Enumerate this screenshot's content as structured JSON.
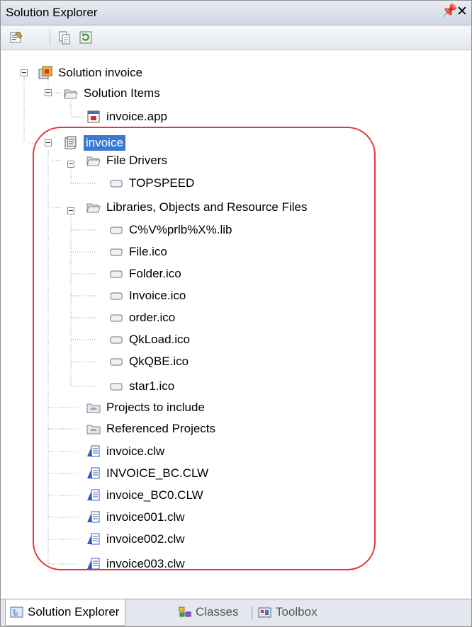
{
  "window": {
    "title": "Solution Explorer",
    "pin_glyph": "Ũ",
    "close_glyph": "✕"
  },
  "toolbar": {
    "buttons": [
      "properties-icon",
      "show-all-files-icon",
      "refresh-icon"
    ]
  },
  "tree": {
    "solution": {
      "label": "Solution invoice",
      "icon": "solution-icon"
    },
    "solution_items": {
      "label": "Solution Items",
      "icon": "folder-open-icon"
    },
    "invoice_app": {
      "label": "invoice.app",
      "icon": "app-file-icon"
    },
    "project": {
      "label": "invoice",
      "icon": "project-icon",
      "selected": true
    },
    "file_drivers": {
      "label": "File Drivers",
      "icon": "folder-open-icon"
    },
    "topspeed": {
      "label": "TOPSPEED",
      "icon": "item-icon"
    },
    "libraries": {
      "label": "Libraries, Objects and Resource Files",
      "icon": "folder-open-icon"
    },
    "library_items": [
      "C%V%prlb%X%.lib",
      "File.ico",
      "Folder.ico",
      "Invoice.ico",
      "order.ico",
      "QkLoad.ico",
      "QkQBE.ico",
      "star1.ico"
    ],
    "projects_to_include": {
      "label": "Projects to include",
      "icon": "folder-closed-icon"
    },
    "referenced_projects": {
      "label": "Referenced Projects",
      "icon": "folder-closed-icon"
    },
    "source_files": [
      "invoice.clw",
      "INVOICE_BC.CLW",
      "invoice_BC0.CLW",
      "invoice001.clw",
      "invoice002.clw",
      "invoice003.clw"
    ]
  },
  "tabs": [
    {
      "label": "Solution Explorer",
      "icon": "solution-explorer-icon",
      "active": true
    },
    {
      "label": "Classes",
      "icon": "classes-icon",
      "active": false
    },
    {
      "label": "Toolbox",
      "icon": "toolbox-icon",
      "active": false
    }
  ],
  "colors": {
    "selection": "#3a78d4",
    "highlight_outline": "#e8343a",
    "title_bar": "#d6dde8"
  }
}
